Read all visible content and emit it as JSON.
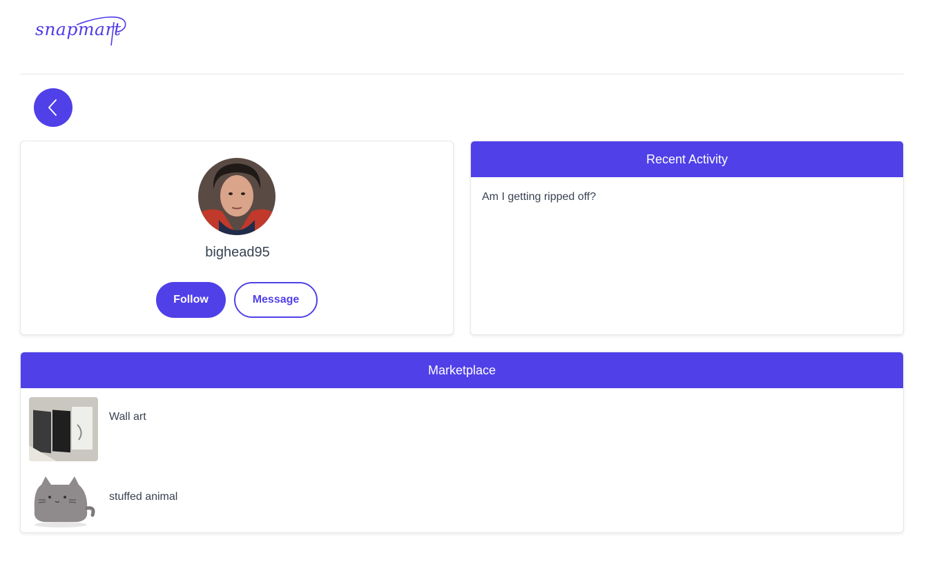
{
  "brand": {
    "logo_text": "snapmart",
    "color": "#5040e8"
  },
  "nav": {
    "back_icon": "chevron-left-icon"
  },
  "profile": {
    "username": "bighead95",
    "follow_label": "Follow",
    "message_label": "Message"
  },
  "activity": {
    "title": "Recent Activity",
    "items": [
      "Am I getting ripped off?"
    ]
  },
  "marketplace": {
    "title": "Marketplace",
    "items": [
      {
        "label": "Wall art"
      },
      {
        "label": "stuffed animal"
      }
    ]
  }
}
